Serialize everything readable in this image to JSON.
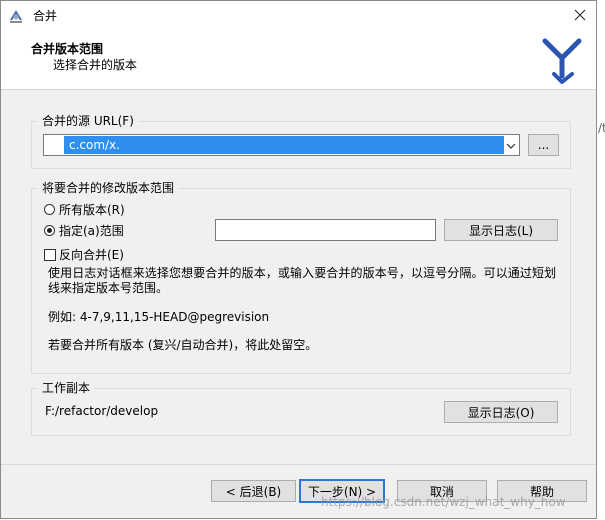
{
  "window": {
    "title": "合并"
  },
  "header": {
    "title": "合并版本范围",
    "subtitle": "选择合并的版本"
  },
  "source_group": {
    "legend": "合并的源 URL(F)",
    "url_value": "c.com/x.",
    "browse_label": "..."
  },
  "range_group": {
    "legend": "将要合并的修改版本范围",
    "radio_all": "所有版本(R)",
    "radio_specific": "指定(a)范围",
    "show_log_label": "显示日志(L)",
    "reverse_merge": "反向合并(E)",
    "help_line1": "使用日志对话框来选择您想要合并的版本，或输入要合并的版本号，以逗号分隔。可以通过短划",
    "help_line2": "线来指定版本号范围。",
    "example": "例如: 4-7,9,11,15-HEAD@pegrevision",
    "note": "若要合并所有版本 (复兴/自动合并)，将此处留空。"
  },
  "working_copy_group": {
    "legend": "工作副本",
    "path": "F:/refactor/develop",
    "show_log_label": "显示日志(O)"
  },
  "footer": {
    "back": "< 后退(B)",
    "next": "下一步(N) >",
    "cancel": "取消",
    "help": "帮助"
  },
  "watermark": "https://blog.csdn.net/wzj_what_why_how",
  "background_fragment": "/t"
}
